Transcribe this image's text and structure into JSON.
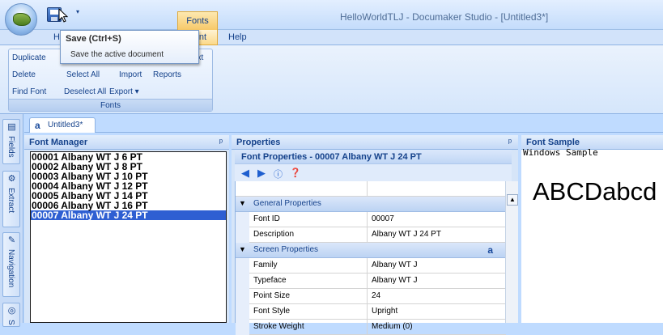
{
  "window": {
    "title": "HelloWorldTLJ - Documaker Studio - [Untitled3*]"
  },
  "qat": {
    "dropdown_glyph": "▾"
  },
  "context_tab": {
    "label": "Fonts"
  },
  "ribbon_tabs": {
    "home_partial": "H",
    "font": "Font",
    "help": "Help"
  },
  "tooltip": {
    "title": "Save (Ctrl+S)",
    "description": "Save the active document"
  },
  "ribbon": {
    "group_caption": "Fonts",
    "buttons": {
      "duplicate": "Duplicate",
      "text": "Text",
      "delete": "Delete",
      "select_all": "Select All",
      "import": "Import",
      "reports": "Reports",
      "find_font": "Find Font",
      "deselect_all": "Deselect All",
      "export": "Export ▾"
    }
  },
  "left_dock": {
    "fields": "Fields",
    "extract": "Extract",
    "navigation": "Navigation",
    "s": "S"
  },
  "doc_tab": {
    "label": "Untitled3*",
    "icon": "a"
  },
  "font_manager": {
    "title": "Font Manager",
    "pin": "ᵖ",
    "items": [
      "00001  Albany WT J 6 PT",
      "00002  Albany WT J 8 PT",
      "00003  Albany WT J 10 PT",
      "00004  Albany WT J 12 PT",
      "00005  Albany WT J 14 PT",
      "00006  Albany WT J 16 PT",
      "00007  Albany WT J 24 PT"
    ],
    "selected_index": 6
  },
  "properties": {
    "title": "Properties",
    "pin": "ᵖ",
    "subtitle": "Font Properties - 00007  Albany WT J 24 PT",
    "categories": {
      "general": "General Properties",
      "screen": "Screen Properties"
    },
    "rows": {
      "font_id": {
        "k": "Font ID",
        "v": "00007"
      },
      "description": {
        "k": "Description",
        "v": "Albany WT J 24 PT"
      },
      "family": {
        "k": "Family",
        "v": "Albany WT J"
      },
      "typeface": {
        "k": "Typeface",
        "v": "Albany WT J"
      },
      "point_size": {
        "k": "Point Size",
        "v": "24"
      },
      "font_style": {
        "k": "Font Style",
        "v": "Upright"
      },
      "stroke_weight": {
        "k": "Stroke Weight",
        "v": "Medium (0)"
      }
    }
  },
  "font_sample": {
    "title": "Font Sample",
    "small": "Windows Sample",
    "big": "ABCDabcd"
  },
  "colors": {
    "selection": "#2e5fd2",
    "ribbon_context": "#f7c969",
    "panel_bg": "#d6e5f8"
  }
}
